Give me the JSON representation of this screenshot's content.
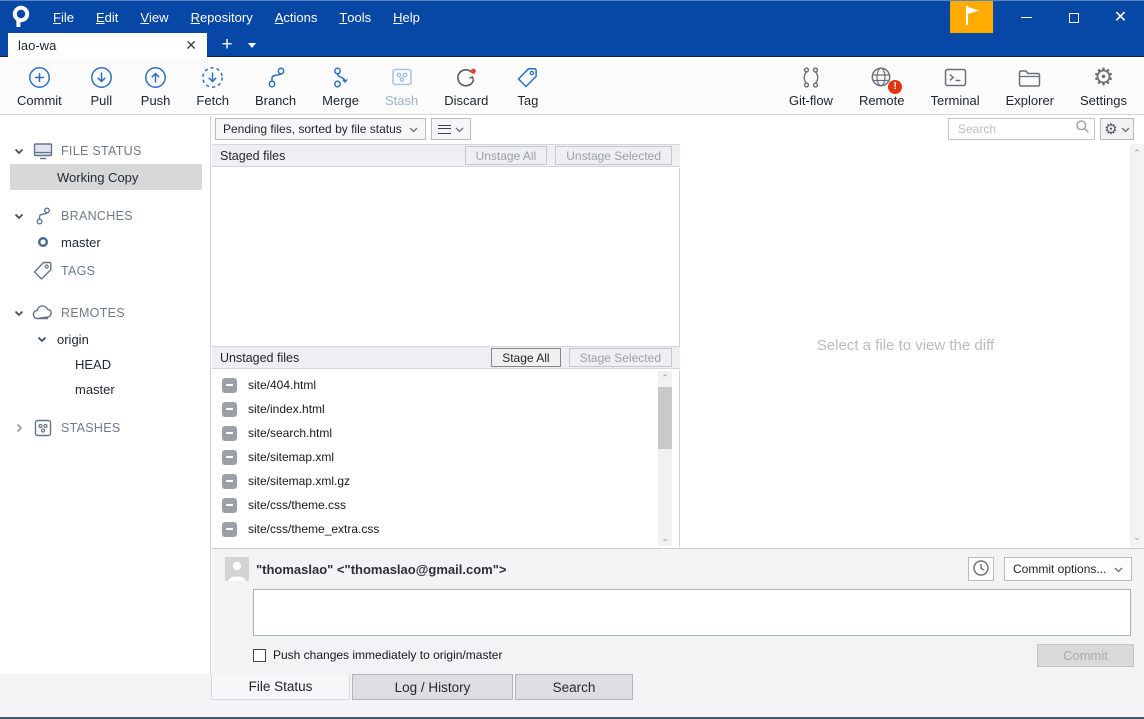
{
  "titlebar": {
    "menus": [
      "File",
      "Edit",
      "View",
      "Repository",
      "Actions",
      "Tools",
      "Help"
    ]
  },
  "tabbar": {
    "active_tab": "lao-wa"
  },
  "toolbar": {
    "left": [
      {
        "label": "Commit"
      },
      {
        "label": "Pull"
      },
      {
        "label": "Push"
      },
      {
        "label": "Fetch"
      },
      {
        "label": "Branch"
      },
      {
        "label": "Merge"
      },
      {
        "label": "Stash",
        "disabled": true
      },
      {
        "label": "Discard"
      },
      {
        "label": "Tag"
      }
    ],
    "right": [
      {
        "label": "Git-flow"
      },
      {
        "label": "Remote",
        "badge": "!"
      },
      {
        "label": "Terminal"
      },
      {
        "label": "Explorer"
      },
      {
        "label": "Settings"
      }
    ]
  },
  "sidebar": {
    "sections": [
      {
        "label": "FILE STATUS",
        "children": [
          {
            "label": "Working Copy",
            "selected": true
          }
        ]
      },
      {
        "label": "BRANCHES",
        "children": [
          {
            "label": "master"
          }
        ]
      },
      {
        "label": "TAGS"
      },
      {
        "label": "REMOTES",
        "children": [
          {
            "label": "origin",
            "children": [
              {
                "label": "HEAD"
              },
              {
                "label": "master"
              }
            ]
          }
        ]
      },
      {
        "label": "STASHES"
      }
    ]
  },
  "main": {
    "filter_dropdown": "Pending files, sorted by file status",
    "search": {
      "placeholder": "Search"
    },
    "staged": {
      "title": "Staged files",
      "buttons": {
        "unstage_all": "Unstage All",
        "unstage_selected": "Unstage Selected"
      }
    },
    "unstaged": {
      "title": "Unstaged files",
      "buttons": {
        "stage_all": "Stage All",
        "stage_selected": "Stage Selected"
      },
      "files": [
        "site/404.html",
        "site/index.html",
        "site/search.html",
        "site/sitemap.xml",
        "site/sitemap.xml.gz",
        "site/css/theme.css",
        "site/css/theme_extra.css"
      ]
    },
    "diff": {
      "placeholder": "Select a file to view the diff"
    }
  },
  "commit_panel": {
    "author": "\"thomaslao\" <\"thomaslao@gmail.com\">",
    "options_button": "Commit options...",
    "push_checkbox": "Push changes immediately to origin/master",
    "commit_button": "Commit"
  },
  "footer_tabs": [
    "File Status",
    "Log / History",
    "Search"
  ],
  "colors": {
    "titlebar_blue": "#0747A6",
    "toolbar_icon_blue": "#2B6FBF",
    "flag_orange": "#FFAB00",
    "badge_red": "#DE350B",
    "disabled_icon_blue": "#A9C3DD"
  }
}
